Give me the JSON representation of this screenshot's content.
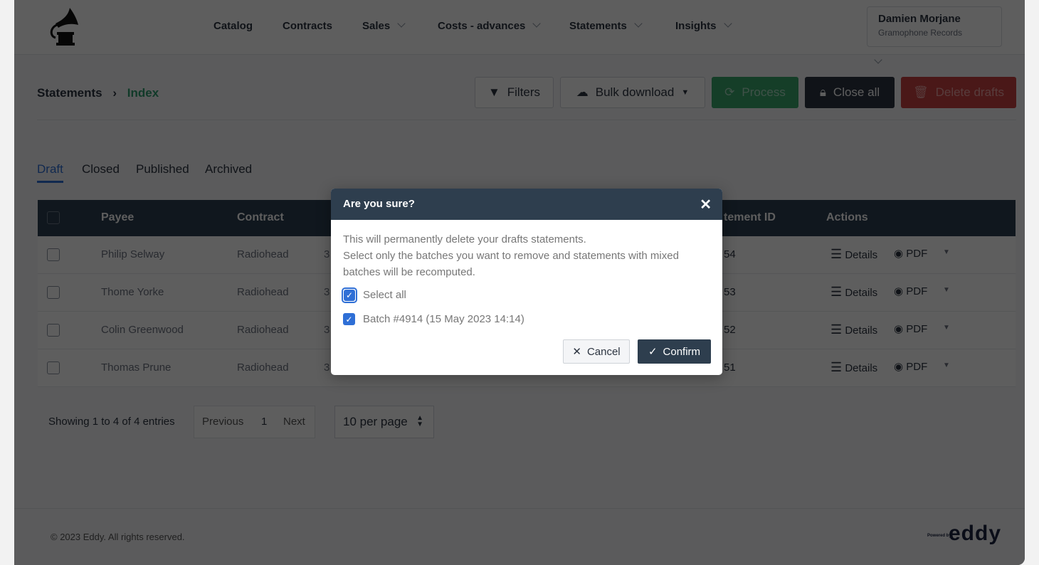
{
  "header": {
    "nav": [
      {
        "label": "Catalog"
      },
      {
        "label": "Contracts"
      },
      {
        "label": "Sales"
      },
      {
        "label": "Costs - advances"
      },
      {
        "label": "Statements"
      },
      {
        "label": "Insights"
      }
    ],
    "user_name": "Damien Morjane",
    "company": "Gramophone Records"
  },
  "breadcrumb": {
    "parent": "Statements",
    "current": "Index"
  },
  "toolbar": {
    "filters": "Filters",
    "bulk_download": "Bulk download",
    "process": "Process",
    "close_all": "Close all",
    "delete_drafts": "Delete drafts"
  },
  "colors": {
    "accent": "#2f9e6e",
    "process": "#3aa76d",
    "close_all": "#2c3440",
    "delete": "#d9534f",
    "table_header": "#2c3e50",
    "checkbox": "#2f6fd6"
  },
  "tabs": [
    {
      "label": "Draft",
      "active": true
    },
    {
      "label": "Closed"
    },
    {
      "label": "Published"
    },
    {
      "label": "Archived"
    }
  ],
  "table": {
    "columns": [
      "Payee",
      "Contract",
      "tement ID",
      "Actions"
    ],
    "rows": [
      {
        "payee": "Philip Selway",
        "contract": "Radiohead",
        "col3": "3",
        "id": "54"
      },
      {
        "payee": "Thome Yorke",
        "contract": "Radiohead",
        "col3": "3",
        "id": "53"
      },
      {
        "payee": "Colin Greenwood",
        "contract": "Radiohead",
        "col3": "3",
        "id": "52"
      },
      {
        "payee": "Thomas Prune",
        "contract": "Radiohead",
        "col3": "3",
        "id": "51"
      }
    ],
    "details": "Details",
    "pdf": "PDF"
  },
  "pagination": {
    "info": "Showing 1 to 4 of 4 entries",
    "previous": "Previous",
    "page": "1",
    "next": "Next",
    "per_page": "10 per page"
  },
  "footer": {
    "copyright": "© 2023 Eddy. All rights reserved.",
    "powered_by": "Powered by",
    "brand": "eddy"
  },
  "modal": {
    "title": "Are you sure?",
    "line1": "This will permanently delete your drafts statements.",
    "line2": "Select only the batches you want to remove and statements with mixed batches will be recomputed.",
    "select_all": "Select all",
    "batch": "Batch #4914 (15 May 2023 14:14)",
    "cancel": "Cancel",
    "confirm": "Confirm"
  }
}
